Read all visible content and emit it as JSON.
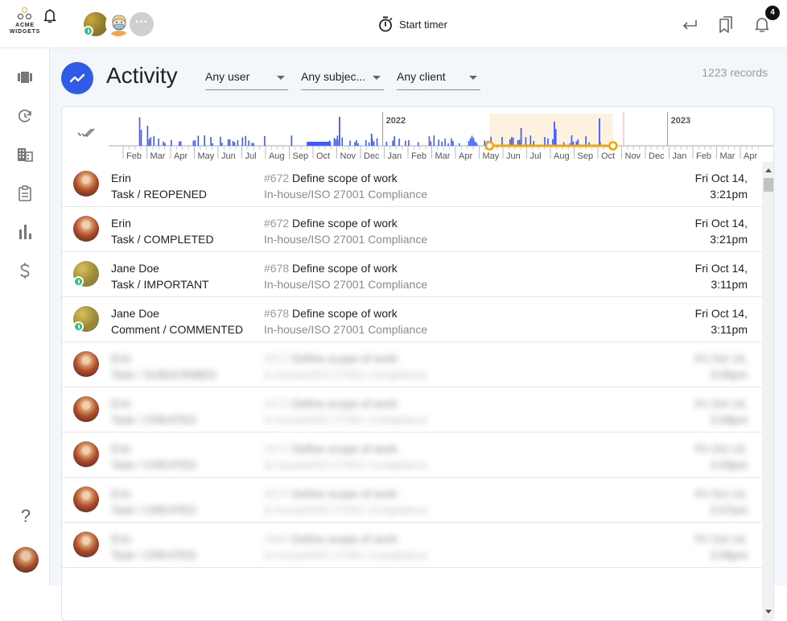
{
  "app": {
    "logo_line1": "ACME",
    "logo_line2": "WIDGETS"
  },
  "topbar": {
    "team_more_label": "···",
    "start_timer_label": "Start timer",
    "notification_count": "4",
    "icons": [
      "bell-icon",
      "timer-icon",
      "undo-icon",
      "bookmarks-icon",
      "notifications-bell-icon"
    ]
  },
  "sidebar": {
    "items": [
      {
        "icon": "carousel-icon",
        "label": "Boards"
      },
      {
        "icon": "history-icon",
        "label": "Activity"
      },
      {
        "icon": "building-icon",
        "label": "Clients"
      },
      {
        "icon": "clipboard-icon",
        "label": "Tasks"
      },
      {
        "icon": "bar-chart-icon",
        "label": "Reports"
      },
      {
        "icon": "dollar-icon",
        "label": "Billing"
      }
    ],
    "help_label": "?"
  },
  "page": {
    "title": "Activity",
    "filters": {
      "user": "Any user",
      "subject": "Any subjec...",
      "client": "Any client"
    },
    "record_count": "1223 records"
  },
  "timeline": {
    "year_labels": [
      "2022",
      "2023"
    ],
    "month_labels": [
      "Feb",
      "Mar",
      "Apr",
      "May",
      "Jun",
      "Jul",
      "Aug",
      "Sep",
      "Oct",
      "Nov",
      "Dec",
      "Jan",
      "Feb",
      "Mar",
      "Apr",
      "May",
      "Jun",
      "Jul",
      "Aug",
      "Sep",
      "Oct",
      "Nov",
      "Dec",
      "Jan",
      "Feb",
      "Mar",
      "Apr"
    ],
    "selected_range": {
      "start": "May 2022",
      "end": "Oct 2022"
    },
    "bar_color": "#3d5afe",
    "range_color": "#f5a400"
  },
  "activities": [
    {
      "user": "Erin",
      "avatar": "erin",
      "online": false,
      "action": "Task / REOPENED",
      "task_number": "#672",
      "task_title": "Define scope of work",
      "project": "In-house/ISO 27001 Compliance",
      "date": "Fri Oct 14,",
      "time": "3:21pm",
      "blurred": false
    },
    {
      "user": "Erin",
      "avatar": "erin",
      "online": false,
      "action": "Task / COMPLETED",
      "task_number": "#672",
      "task_title": "Define scope of work",
      "project": "In-house/ISO 27001 Compliance",
      "date": "Fri Oct 14,",
      "time": "3:21pm",
      "blurred": false
    },
    {
      "user": "Jane Doe",
      "avatar": "jane",
      "online": true,
      "action": "Task / IMPORTANT",
      "task_number": "#678",
      "task_title": "Define scope of work",
      "project": "In-house/ISO 27001 Compliance",
      "date": "Fri Oct 14,",
      "time": "3:11pm",
      "blurred": false
    },
    {
      "user": "Jane Doe",
      "avatar": "jane",
      "online": true,
      "action": "Comment / COMMENTED",
      "task_number": "#678",
      "task_title": "Define scope of work",
      "project": "In-house/ISO 27001 Compliance",
      "date": "Fri Oct 14,",
      "time": "3:11pm",
      "blurred": false
    },
    {
      "user": "Erin",
      "avatar": "erin",
      "online": false,
      "action": "Task / SUBSCRIBED",
      "task_number": "#672",
      "task_title": "Define scope of work",
      "project": "In-house/ISO 27001 Compliance",
      "date": "Fri Oct 14,",
      "time": "3:09pm",
      "blurred": true
    },
    {
      "user": "Erin",
      "avatar": "erin",
      "online": false,
      "action": "Task / CREATED",
      "task_number": "#672",
      "task_title": "Define scope of work",
      "project": "In-house/ISO 27001 Compliance",
      "date": "Fri Oct 14,",
      "time": "3:09pm",
      "blurred": true
    },
    {
      "user": "Erin",
      "avatar": "erin",
      "online": false,
      "action": "Task / CREATED",
      "task_number": "#671",
      "task_title": "Define scope of work",
      "project": "In-house/ISO 27001 Compliance",
      "date": "Fri Oct 14,",
      "time": "3:09pm",
      "blurred": true
    },
    {
      "user": "Erin",
      "avatar": "erin",
      "online": false,
      "action": "Task / CREATED",
      "task_number": "#670",
      "task_title": "Define scope of work",
      "project": "In-house/ISO 27001 Compliance",
      "date": "Fri Oct 14,",
      "time": "3:07pm",
      "blurred": true
    },
    {
      "user": "Erin",
      "avatar": "erin",
      "online": false,
      "action": "Task / CREATED",
      "task_number": "#669",
      "task_title": "Define scope of work",
      "project": "In-house/ISO 27001 Compliance",
      "date": "Fri Oct 14,",
      "time": "3:06pm",
      "blurred": true
    }
  ]
}
